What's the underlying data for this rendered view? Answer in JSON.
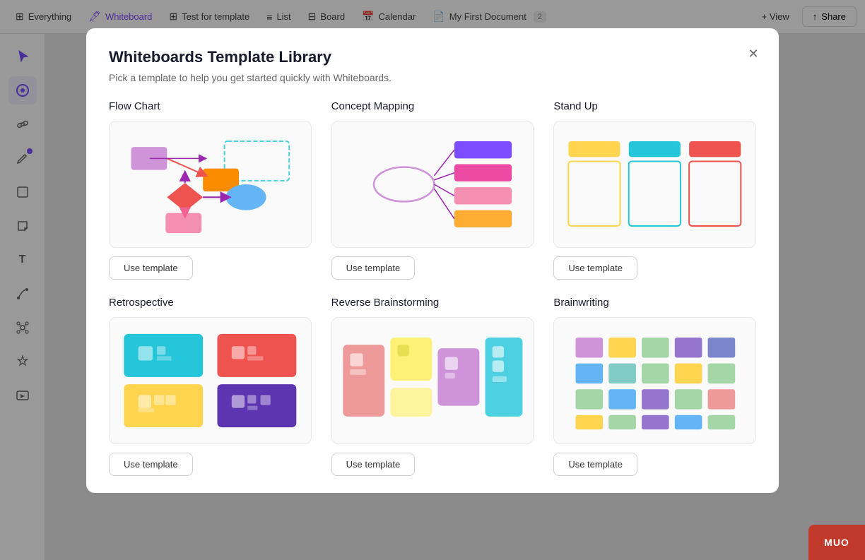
{
  "topbar": {
    "everything_label": "Everything",
    "whiteboard_label": "Whiteboard",
    "test_template_label": "Test for template",
    "list_label": "List",
    "board_label": "Board",
    "calendar_label": "Calendar",
    "doc_label": "My First Document",
    "doc_badge": "2",
    "view_label": "+ View",
    "share_label": "Share"
  },
  "modal": {
    "title": "Whiteboards Template Library",
    "subtitle": "Pick a template to help you get started quickly with Whiteboards.",
    "templates": [
      {
        "name": "Flow Chart",
        "use_btn": "Use template",
        "type": "flowchart"
      },
      {
        "name": "Concept Mapping",
        "use_btn": "Use template",
        "type": "concept"
      },
      {
        "name": "Stand Up",
        "use_btn": "Use template",
        "type": "standup"
      },
      {
        "name": "Retrospective",
        "use_btn": "Use template",
        "type": "retro"
      },
      {
        "name": "Reverse Brainstorming",
        "use_btn": "Use template",
        "type": "brainstorm"
      },
      {
        "name": "Brainwriting",
        "use_btn": "Use template",
        "type": "brainwriting"
      }
    ]
  },
  "muo": {
    "label": "MUO"
  }
}
